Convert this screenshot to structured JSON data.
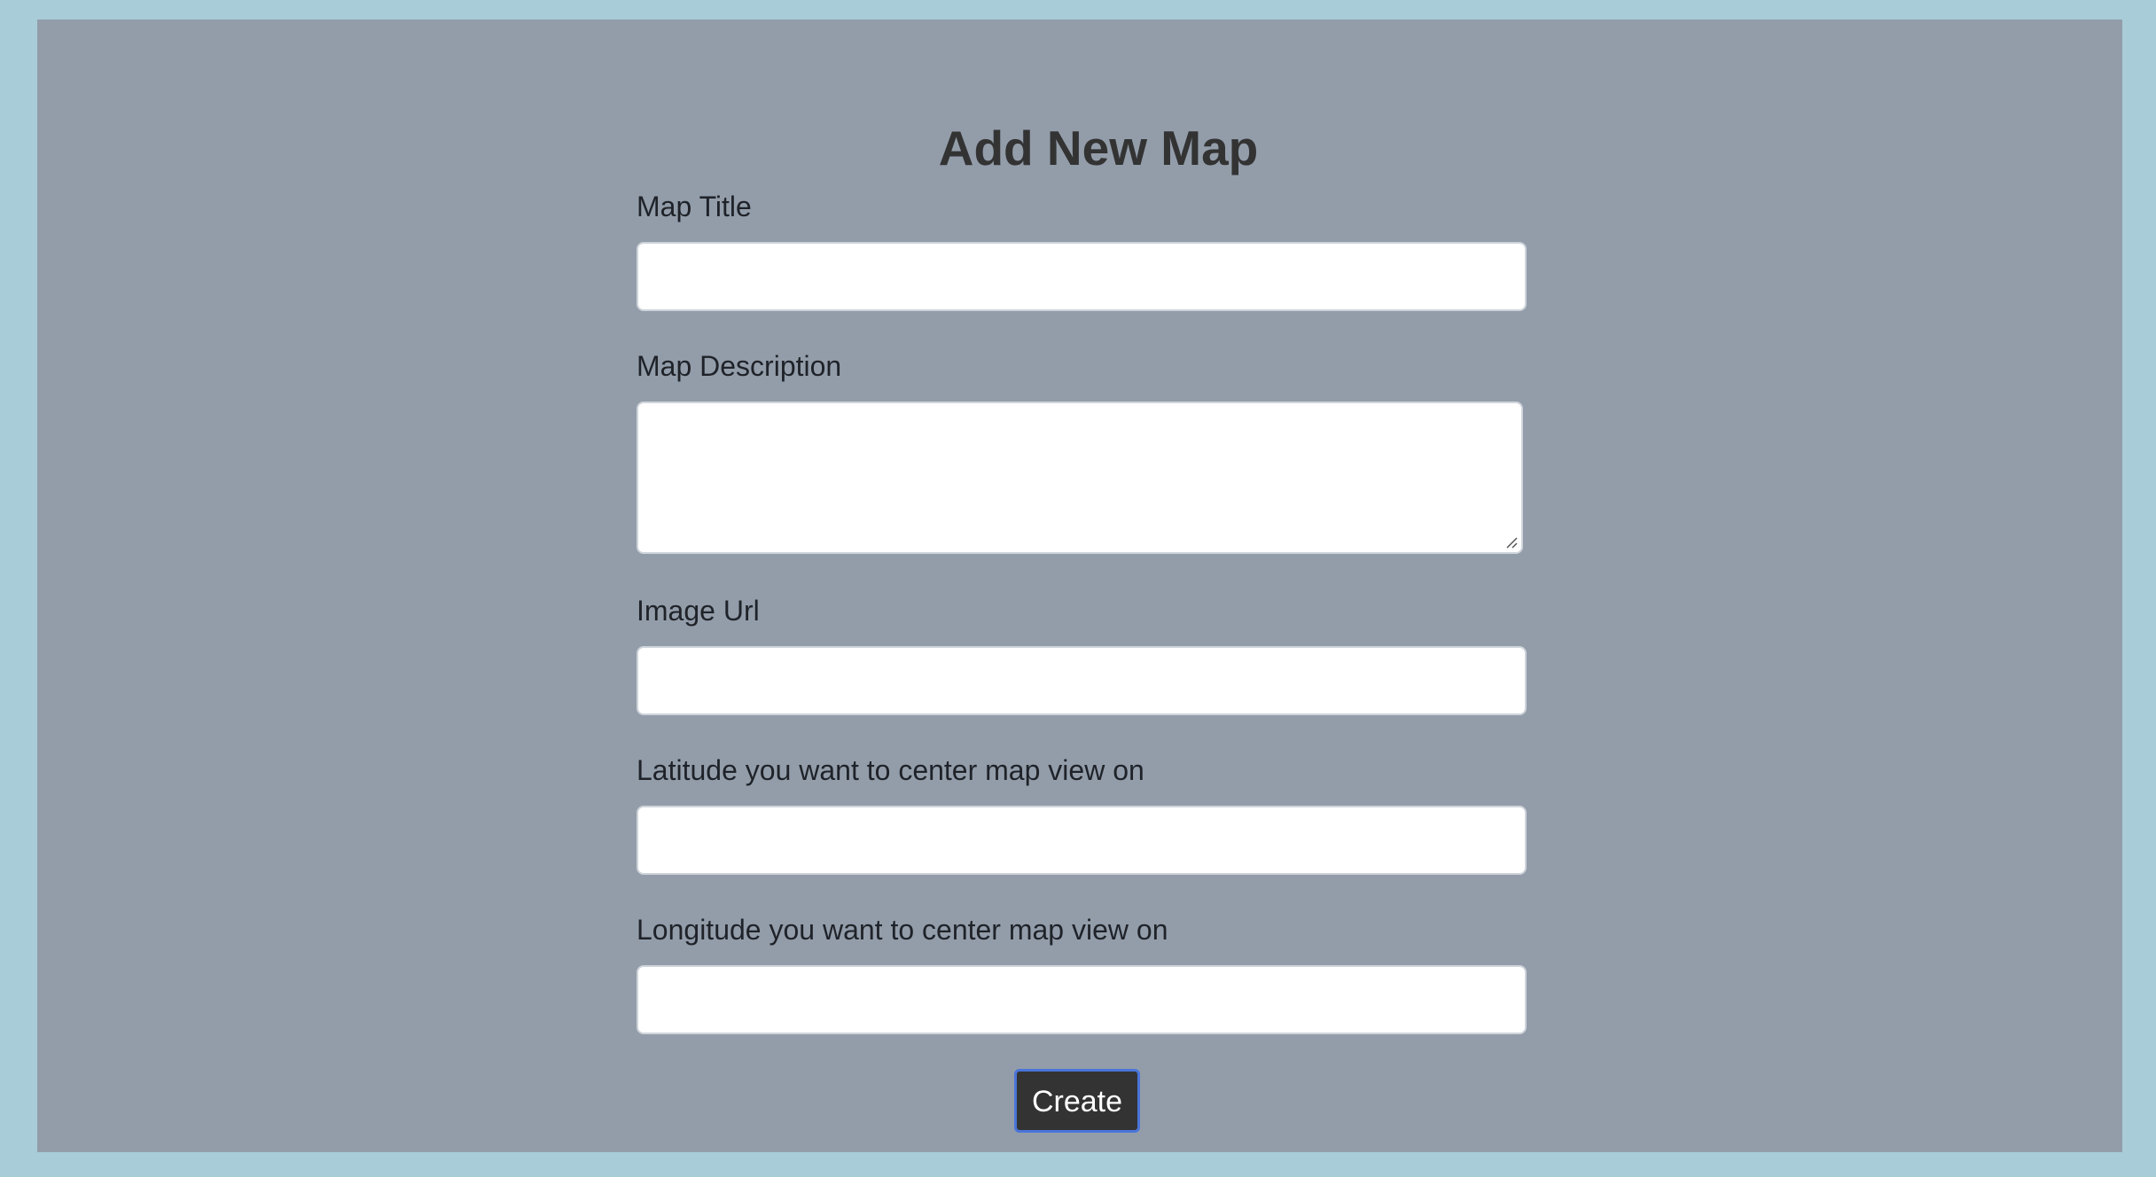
{
  "form": {
    "title": "Add New Map",
    "fields": {
      "map_title": {
        "label": "Map Title",
        "value": ""
      },
      "map_description": {
        "label": "Map Description",
        "value": ""
      },
      "image_url": {
        "label": "Image Url",
        "value": ""
      },
      "latitude": {
        "label": "Latitude you want to center map view on",
        "value": ""
      },
      "longitude": {
        "label": "Longitude you want to center map view on",
        "value": ""
      }
    },
    "submit_label": "Create"
  },
  "colors": {
    "page_background": "#a8cdd8",
    "panel_background": "#939daa",
    "button_background": "#333333",
    "button_border": "#4a74d9"
  }
}
